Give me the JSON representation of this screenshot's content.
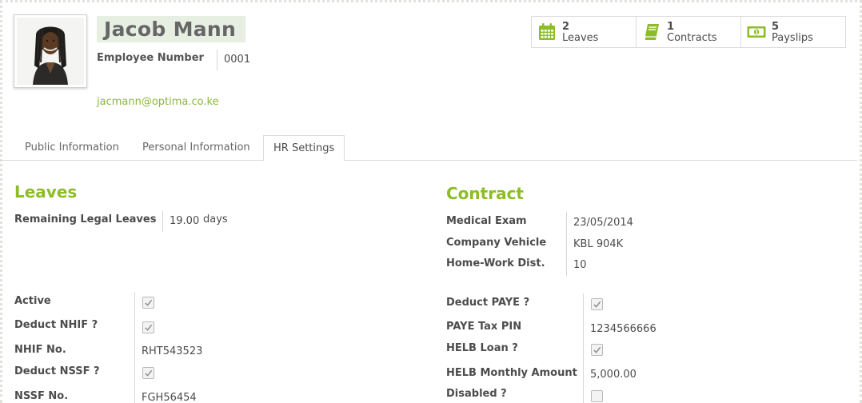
{
  "employee": {
    "name": "Jacob Mann",
    "number_label": "Employee Number",
    "number": "0001",
    "email": "jacmann@optima.co.ke"
  },
  "stats": [
    {
      "count": "2",
      "label": "Leaves",
      "icon": "calendar-icon"
    },
    {
      "count": "1",
      "label": "Contracts",
      "icon": "book-icon"
    },
    {
      "count": "5",
      "label": "Payslips",
      "icon": "money-icon"
    }
  ],
  "tabs": [
    {
      "label": "Public Information"
    },
    {
      "label": "Personal Information"
    },
    {
      "label": "HR Settings",
      "active": true
    }
  ],
  "leaves": {
    "title": "Leaves",
    "remaining_label": "Remaining Legal Leaves",
    "remaining_value": "19.00",
    "remaining_unit": "days"
  },
  "contract": {
    "title": "Contract",
    "medical_exam_label": "Medical Exam",
    "medical_exam_value": "23/05/2014",
    "vehicle_label": "Company Vehicle",
    "vehicle_value": "KBL 904K",
    "distance_label": "Home-Work Dist.",
    "distance_value": "10"
  },
  "left_fields": {
    "active_label": "Active",
    "active": true,
    "deduct_nhif_label": "Deduct NHIF ?",
    "deduct_nhif": true,
    "nhif_no_label": "NHIF No.",
    "nhif_no": "RHT543523",
    "deduct_nssf_label": "Deduct NSSF ?",
    "deduct_nssf": true,
    "nssf_no_label": "NSSF No.",
    "nssf_no": "FGH56454"
  },
  "right_fields": {
    "deduct_paye_label": "Deduct PAYE ?",
    "deduct_paye": true,
    "paye_pin_label": "PAYE Tax PIN",
    "paye_pin": "1234566666",
    "helb_loan_label": "HELB Loan ?",
    "helb_loan": true,
    "helb_amount_label": "HELB Monthly Amount",
    "helb_amount": "5,000.00",
    "disabled_label": "Disabled ?",
    "disabled": false
  },
  "colors": {
    "accent": "#8cbd26",
    "name_bg": "#e7eee2"
  }
}
